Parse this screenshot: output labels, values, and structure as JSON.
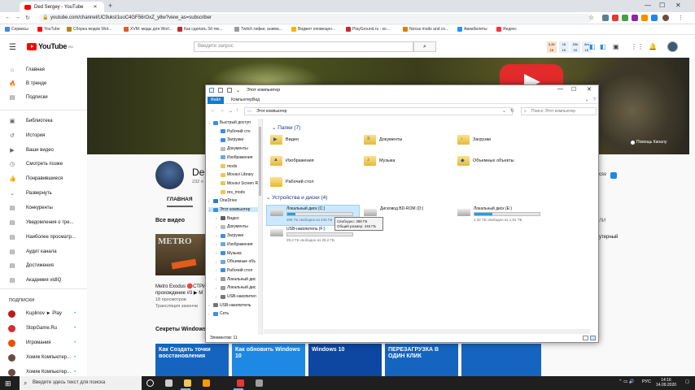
{
  "browser": {
    "tabs": [
      {
        "title": "Ded Sergey - YouTube",
        "close": "✕"
      }
    ],
    "new_tab": "+",
    "window_controls": [
      "—",
      "☐",
      "✕"
    ],
    "nav": {
      "back": "←",
      "forward": "→",
      "reload": "↻"
    },
    "url": "youtube.com/channel/UC9uksI1uoC4GF56rOxZ_y8w?view_as=subscriber",
    "bookmarks": [
      {
        "label": "Сервисы",
        "color": "#4285f4"
      },
      {
        "label": "YouTube",
        "color": "#ff0000"
      },
      {
        "label": "Сборка модов Wot...",
        "color": "#b8860b"
      },
      {
        "label": "XVM: моды для Worl...",
        "color": "#e35c1b"
      },
      {
        "label": "Как сделать 3d тек...",
        "color": "#c62828"
      },
      {
        "label": "Twitch гифки, анима...",
        "color": "#999999"
      },
      {
        "label": "Виджет оповещен...",
        "color": "#f4b400"
      },
      {
        "label": "PlayGround.ru - ко...",
        "color": "#c62828"
      },
      {
        "label": "Nexus mods and co...",
        "color": "#e57c00"
      },
      {
        "label": "Авиабилеты",
        "color": "#2196f3"
      },
      {
        "label": "Яндекс",
        "color": "#ff3333"
      }
    ]
  },
  "youtube": {
    "logo_text": "YouTube",
    "logo_region": "RU",
    "search_placeholder": "Введите запрос",
    "search_icon": "search-icon",
    "header_stats": [
      {
        "label": "3,2K",
        "sub": "1K",
        "color": "#fbe3c8"
      },
      {
        "label": "16",
        "sub": "1K",
        "color": "#e8f0fb"
      },
      {
        "label": "93h",
        "sub": "1K",
        "color": "#e8f0fb"
      },
      {
        "label": "8m",
        "sub": "1K",
        "color": "#e8f0fb"
      }
    ],
    "sidebar": {
      "items": [
        {
          "icon": "⌂",
          "label": "Главная"
        },
        {
          "icon": "🔥",
          "label": "В тренде"
        },
        {
          "icon": "▤",
          "label": "Подписки"
        },
        {
          "icon": "▣",
          "label": "Библиотека"
        },
        {
          "icon": "↺",
          "label": "История"
        },
        {
          "icon": "▶",
          "label": "Ваши видео"
        },
        {
          "icon": "◷",
          "label": "Смотреть позже"
        },
        {
          "icon": "👍",
          "label": "Понравившиеся"
        },
        {
          "icon": "⌄",
          "label": "Развернуть"
        },
        {
          "icon": "▤",
          "label": "Конкуренты"
        },
        {
          "icon": "▤",
          "label": "Уведомления о тре..."
        },
        {
          "icon": "▤",
          "label": "Наиболее просматр..."
        },
        {
          "icon": "▤",
          "label": "Аудит канала"
        },
        {
          "icon": "▤",
          "label": "Достижения"
        },
        {
          "icon": "▤",
          "label": "Академия vidIQ"
        }
      ],
      "subs_heading": "ПОДПИСКИ",
      "subs": [
        {
          "label": "Kuplinov ► Play",
          "color": "#b71c1c"
        },
        {
          "label": "StopGame.Ru",
          "color": "#d32f2f"
        },
        {
          "label": "Игромания",
          "color": "#e65100"
        },
        {
          "label": "Хомяк Компьютер...",
          "color": "#6d4c41"
        },
        {
          "label": "Хомяк Компьютер...",
          "color": "#6d4c41"
        }
      ],
      "sub_dot": "•"
    },
    "banner_help": "Помощь Каналу",
    "channel_name": "Ded",
    "channel_subs": "232 п",
    "tab_main": "ГЛАВНАЯ",
    "section_all": "Все видео",
    "metro_thumb": "METRO",
    "video_title": "Metro Exodus 🔴СТРИ",
    "video_title2": "прохождение #3 ▶ М",
    "video_views": "18 просмотров",
    "video_live": "Трансляция закончи",
    "section_2": "Секреты Windows",
    "right_labels": [
      "csv",
      "ЛИ",
      "утерный"
    ],
    "thumbs2": [
      {
        "text": "Как Создать точки восстановления",
        "color": "#1565c0"
      },
      {
        "text": "Как обновить Windows 10",
        "color": "#1e88e5"
      },
      {
        "text": "Windows 10",
        "color": "#0d47a1"
      },
      {
        "text": "ПЕРЕЗАГРУЗКА В ОДИН КЛИК",
        "color": "#1565c0"
      }
    ]
  },
  "explorer": {
    "title": "Этот компьютер",
    "window_controls": [
      "—",
      "☐",
      "✕"
    ],
    "ribbon_tabs": [
      "Файл",
      "Компьютер",
      "Вид"
    ],
    "address": "Этот компьютер",
    "search_placeholder": "Поиск: Этот компьютер",
    "nav_tree": [
      {
        "label": "Быстрый доступ",
        "chev": "⌄",
        "color": "#3d8ee6",
        "indent": 0
      },
      {
        "label": "Рабочий сто",
        "chev": "",
        "color": "#3d8ee6",
        "indent": 1
      },
      {
        "label": "Загрузки",
        "chev": "",
        "color": "#3d8ee6",
        "indent": 1
      },
      {
        "label": "Документы",
        "chev": "",
        "color": "#bbbbbb",
        "indent": 1
      },
      {
        "label": "Изображения",
        "chev": "",
        "color": "#6fa8dc",
        "indent": 1
      },
      {
        "label": "mods",
        "chev": "",
        "color": "#f3c653",
        "indent": 1
      },
      {
        "label": "Movavi Library",
        "chev": "",
        "color": "#f3c653",
        "indent": 1
      },
      {
        "label": "Movavi Screen R",
        "chev": "",
        "color": "#f3c653",
        "indent": 1
      },
      {
        "label": "res_mods",
        "chev": "",
        "color": "#f3c653",
        "indent": 1
      },
      {
        "label": "OneDrive",
        "chev": "›",
        "color": "#2a7bd5",
        "indent": 0
      },
      {
        "label": "Этот компьютер",
        "chev": "⌄",
        "color": "#3d8ee6",
        "indent": 0,
        "selected": true
      },
      {
        "label": "Видео",
        "chev": "›",
        "color": "#5e5e5e",
        "indent": 1
      },
      {
        "label": "Документы",
        "chev": "›",
        "color": "#bbbbbb",
        "indent": 1
      },
      {
        "label": "Загрузки",
        "chev": "›",
        "color": "#3d8ee6",
        "indent": 1
      },
      {
        "label": "Изображения",
        "chev": "›",
        "color": "#6fa8dc",
        "indent": 1
      },
      {
        "label": "Музыка",
        "chev": "›",
        "color": "#3d8ee6",
        "indent": 1
      },
      {
        "label": "Объемные объ",
        "chev": "›",
        "color": "#6fa8dc",
        "indent": 1
      },
      {
        "label": "Рабочий стол",
        "chev": "›",
        "color": "#3d8ee6",
        "indent": 1
      },
      {
        "label": "Локальный дис",
        "chev": "›",
        "color": "#999999",
        "indent": 1
      },
      {
        "label": "Локальный дис",
        "chev": "›",
        "color": "#999999",
        "indent": 1
      },
      {
        "label": "USB-накопител",
        "chev": "›",
        "color": "#777777",
        "indent": 1
      },
      {
        "label": "USB-накопитель",
        "chev": "›",
        "color": "#777777",
        "indent": 0
      },
      {
        "label": "Сеть",
        "chev": "›",
        "color": "#3d8ee6",
        "indent": 0
      }
    ],
    "folders_group": "Папки",
    "folders_count": "(7)",
    "folders": [
      {
        "label": "Видео",
        "badge": "▶"
      },
      {
        "label": "Документы",
        "badge": "≡"
      },
      {
        "label": "Загрузки",
        "badge": "↓"
      },
      {
        "label": "Изображения",
        "badge": "▲"
      },
      {
        "label": "Музыка",
        "badge": "♪"
      },
      {
        "label": "Объемные объекты",
        "badge": "◆"
      },
      {
        "label": "Рабочий стол",
        "badge": ""
      }
    ],
    "drives_group": "Устройства и диски",
    "drives_count": "(4)",
    "drives": [
      {
        "name": "Локальный диск (C:)",
        "free": "388 ГБ свободно из 446 ГБ",
        "used_fraction": 0.13
      },
      {
        "name": "Дисковод BD-ROM (D:)",
        "free": "",
        "used_fraction": null
      },
      {
        "name": "Локальный диск (E:)",
        "free": "1,32 ТБ свободно из 1,81 ТБ",
        "used_fraction": 0.27
      },
      {
        "name": "USB-накопитель (F:)",
        "free": "29,2 ГБ свободно из 29,2 ГБ",
        "used_fraction": 0.0
      }
    ],
    "tooltip_free": "Свободно: 388 ГБ",
    "tooltip_total": "Общий размер: 446 ГБ",
    "status": "Элементов: 11"
  },
  "taskbar": {
    "start": "⊞",
    "search_placeholder": "Введите здесь текст для поиска",
    "apps": [
      {
        "name": "cortana",
        "color": "#ffffff"
      },
      {
        "name": "task-view",
        "color": "#cccccc"
      },
      {
        "name": "file-explorer",
        "color": "#f3c653"
      },
      {
        "name": "app-orange",
        "color": "#ff9800"
      },
      {
        "name": "chrome",
        "color": "#e53935"
      },
      {
        "name": "app-monitor",
        "color": "#9e9e9e"
      }
    ],
    "lang": "РУС",
    "time": "14:16",
    "date": "14.09.2020"
  }
}
